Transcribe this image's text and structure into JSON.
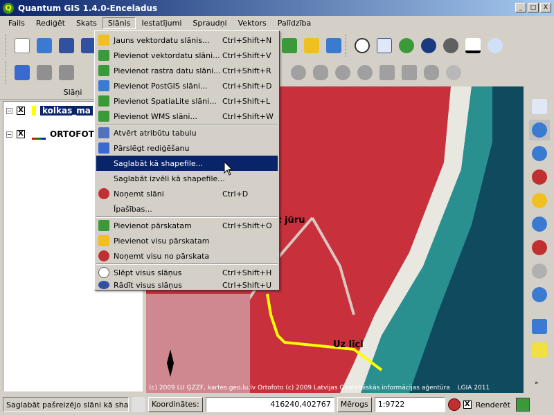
{
  "window": {
    "title": "Quantum GIS 1.4.0-Enceladus",
    "min": "_",
    "max": "□",
    "close": "X"
  },
  "menubar": [
    "Fails",
    "Rediģēt",
    "Skats",
    "Slānis",
    "Iestatījumi",
    "Spraudņi",
    "Vektors",
    "Palīdzība"
  ],
  "menu": {
    "items": [
      {
        "label": "Jauns vektordatu slānis...",
        "shortcut": "Ctrl+Shift+N",
        "icon": "new-vector-icon",
        "color": "#f0c020"
      },
      {
        "label": "Pievienot vektordatu slāni...",
        "shortcut": "Ctrl+Shift+V",
        "icon": "add-vector-icon",
        "color": "#3a9a3a"
      },
      {
        "label": "Pievienot rastra datu slāni...",
        "shortcut": "Ctrl+Shift+R",
        "icon": "add-raster-icon",
        "color": "#3a9a3a"
      },
      {
        "label": "Pievienot PostGIS slāni...",
        "shortcut": "Ctrl+Shift+D",
        "icon": "add-postgis-icon",
        "color": "#3a7ad0"
      },
      {
        "label": "Pievienot SpatiaLite slāni...",
        "shortcut": "Ctrl+Shift+L",
        "icon": "add-spatialite-icon",
        "color": "#3a9a3a"
      },
      {
        "label": "Pievienot WMS slāni...",
        "shortcut": "Ctrl+Shift+W",
        "icon": "add-wms-icon",
        "color": "#3a9a3a"
      },
      {
        "label": "Atvērt atribūtu tabulu",
        "shortcut": "",
        "icon": "attribute-table-icon",
        "color": "#5070c0"
      },
      {
        "label": "Pārslēgt rediģēšanu",
        "shortcut": "",
        "icon": "toggle-editing-icon",
        "color": "#3a6ad0"
      },
      {
        "label": "Saglabāt kā shapefile...",
        "shortcut": "",
        "icon": "",
        "color": ""
      },
      {
        "label": "Saglabāt izvēli kā shapefile...",
        "shortcut": "",
        "icon": "",
        "color": ""
      },
      {
        "label": "Noņemt slāni",
        "shortcut": "Ctrl+D",
        "icon": "remove-layer-icon",
        "color": "#c03030"
      },
      {
        "label": "Īpašības...",
        "shortcut": "",
        "icon": "",
        "color": ""
      },
      {
        "label": "Pievienot pārskatam",
        "shortcut": "Ctrl+Shift+O",
        "icon": "add-overview-icon",
        "color": "#3a9a3a"
      },
      {
        "label": "Pievienot visu pārskatam",
        "shortcut": "",
        "icon": "add-all-overview-icon",
        "color": "#f0c020"
      },
      {
        "label": "Noņemt visu no pārskata",
        "shortcut": "",
        "icon": "remove-all-overview-icon",
        "color": "#c03030"
      },
      {
        "label": "Slēpt visus slāņus",
        "shortcut": "Ctrl+Shift+H",
        "icon": "hide-all-icon",
        "color": "#606060"
      },
      {
        "label": "Rādīt visus slāņus",
        "shortcut": "Ctrl+Shift+U",
        "icon": "show-all-icon",
        "color": "#3050a0"
      }
    ],
    "highlighted": "Saglabāt kā shapefile..."
  },
  "panel": {
    "title": "Slāņi",
    "layers": [
      {
        "name": "kolkas_ma",
        "checked": "X"
      },
      {
        "name": "ORTOFOTO",
        "checked": "X"
      }
    ]
  },
  "map": {
    "labels": [
      "z jūru",
      "Uz līci"
    ],
    "copyright": "(c) 2009 LU ĢZZF, kartes.geo.lu.lv",
    "copyright2": "Ortofoto (c) 2009 Latvijas Ģeotelpiskās informācijas aģentūra",
    "copyright3": "LGIA 2011"
  },
  "status": {
    "message": "Saglabāt pašreizējo slāni kā sha",
    "coord_label": "Koordinātes:",
    "coord_value": "416240,402767",
    "scale_label": "Mērogs",
    "scale_value": "1:9722",
    "render_label": "Renderēt",
    "render_checked": "X"
  },
  "colors": {
    "accent": "#0a246a",
    "map_vegetation": "#c8303c",
    "map_sea": "#1a5f6e",
    "track": "#ffff00"
  }
}
